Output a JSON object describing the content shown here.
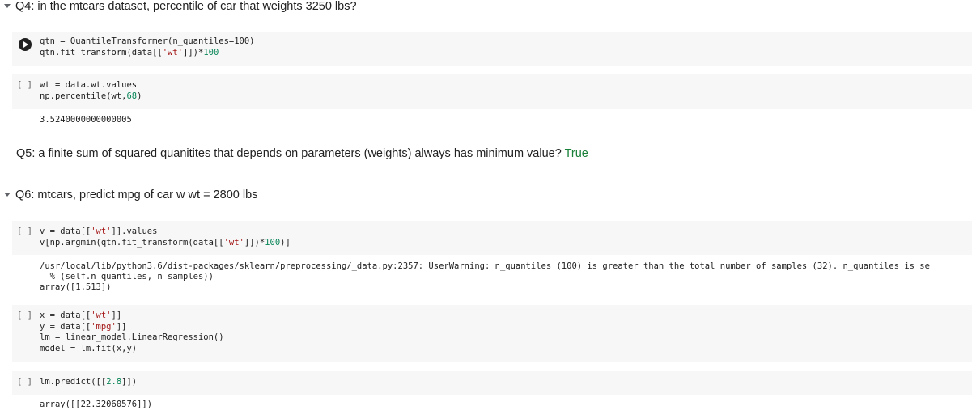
{
  "q4": {
    "title": "Q4: in the mtcars dataset, percentile of car that weights 3250 lbs?"
  },
  "cell1": {
    "line1": "qtn = QuantileTransformer(n_quantiles=100)",
    "line2_pre": "qtn.fit_transform(data[[",
    "line2_str": "'wt'",
    "line2_mid": "]])*",
    "line2_num": "100"
  },
  "cell2": {
    "gutter": "[ ]",
    "line1": "wt = data.wt.values",
    "line2_pre": "np.percentile(wt,",
    "line2_num": "68",
    "line2_post": ")",
    "output": "3.5240000000000005"
  },
  "q5": {
    "text": "Q5: a finite sum of squared quanitites that depends on parameters (weights) always has minimum value?",
    "answer": "True"
  },
  "q6": {
    "title": "Q6: mtcars, predict mpg of car w wt = 2800 lbs"
  },
  "cell3": {
    "gutter": "[ ]",
    "line1_pre": "v = data[[",
    "line1_str": "'wt'",
    "line1_post": "]].values",
    "line2_pre": "v[np.argmin(qtn.fit_transform(data[[",
    "line2_str": "'wt'",
    "line2_mid": "]])*",
    "line2_num": "100",
    "line2_post": ")]",
    "out1": "/usr/local/lib/python3.6/dist-packages/sklearn/preprocessing/_data.py:2357: UserWarning: n_quantiles (100) is greater than the total number of samples (32). n_quantiles is se",
    "out2": "  % (self.n_quantiles, n_samples))",
    "out3": "array([1.513])"
  },
  "cell4": {
    "gutter": "[ ]",
    "line1_pre": "x = data[[",
    "line1_str": "'wt'",
    "line1_post": "]]",
    "line2_pre": "y = data[[",
    "line2_str": "'mpg'",
    "line2_post": "]]",
    "line3": "lm = linear_model.LinearRegression()",
    "line4": "model = lm.fit(x,y)"
  },
  "cell5": {
    "gutter": "[ ]",
    "line1_pre": "lm.predict([[",
    "line1_num": "2.8",
    "line1_post": "]])",
    "output": "array([[22.32060576]])"
  }
}
